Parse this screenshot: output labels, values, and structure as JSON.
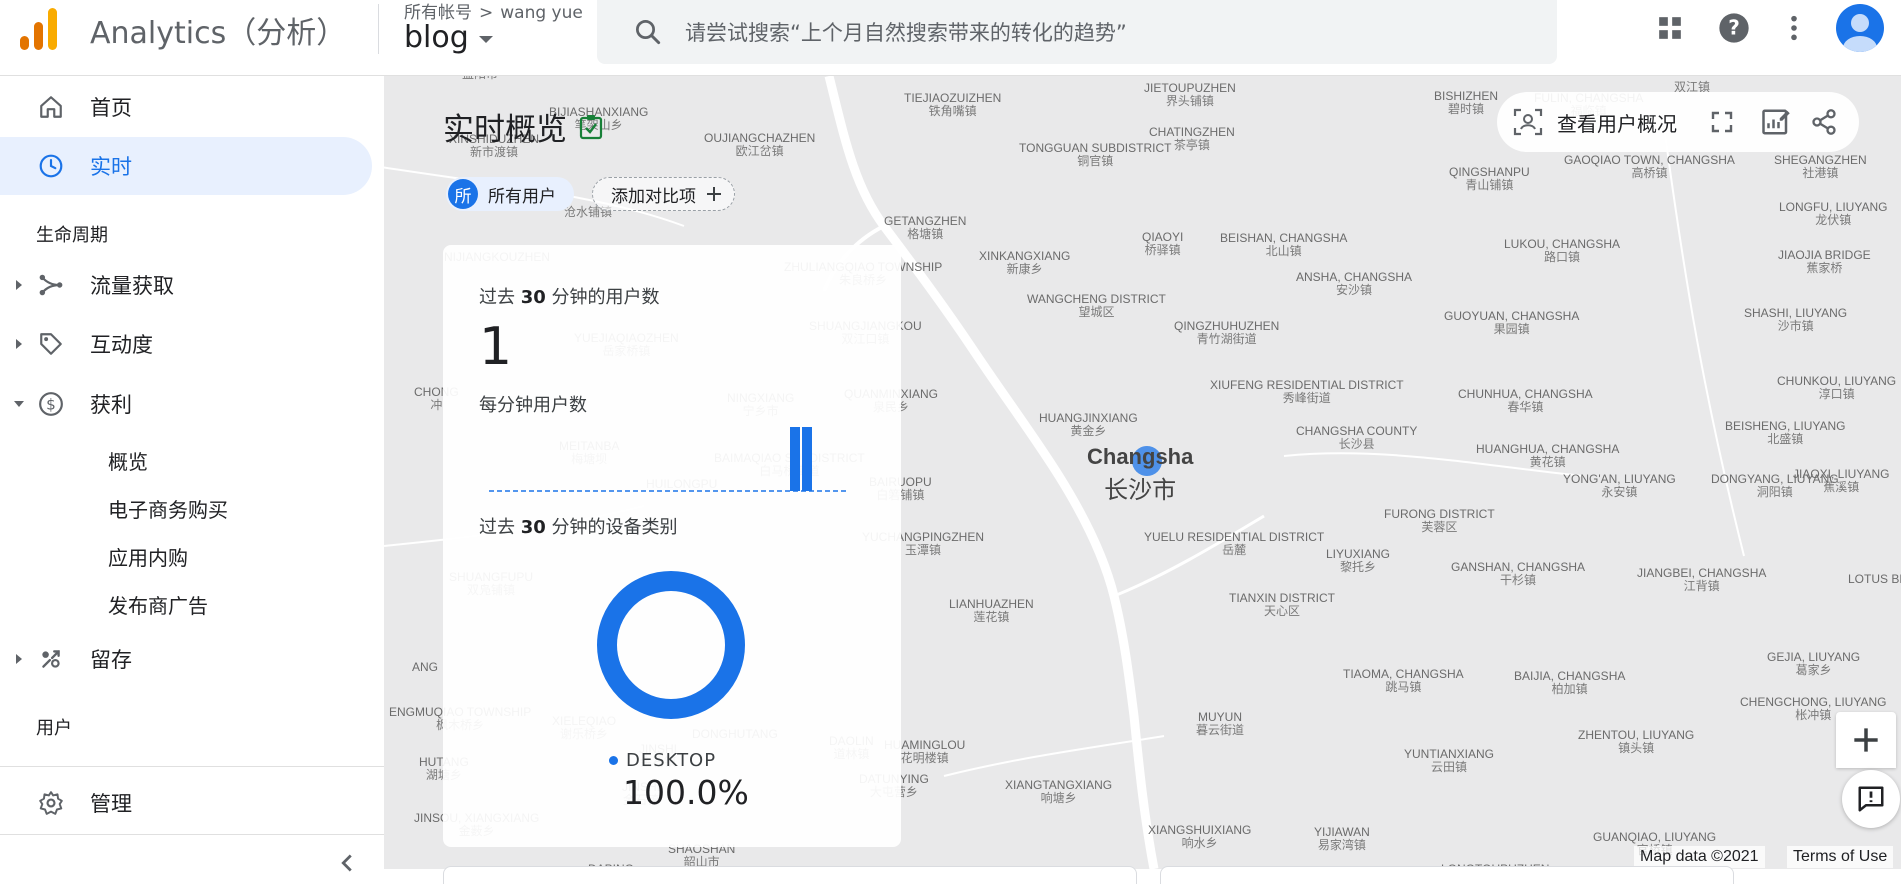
{
  "app": {
    "title": "Analytics（分析）",
    "account_label": "所有帐号",
    "crumb_separator": ">",
    "account_name": "wang yue",
    "property_name": "blog",
    "brand_colors": [
      "#f9ab00",
      "#e37400"
    ]
  },
  "search": {
    "placeholder": "请尝试搜索“上个月自然搜索带来的转化的趋势”",
    "icon": "search-icon"
  },
  "header_icons": [
    "apps-grid-icon",
    "help-icon",
    "more-vert-icon",
    "account-avatar-icon"
  ],
  "sidebar": {
    "home": "首页",
    "realtime": "实时",
    "lifecycle_heading": "生命周期",
    "acquisition": "流量获取",
    "engagement": "互动度",
    "monetization": "获利",
    "monetization_items": [
      "概览",
      "电子商务购买",
      "应用内购",
      "发布商广告"
    ],
    "retention": "留存",
    "user_heading": "用户",
    "admin": "管理"
  },
  "page": {
    "title": "实时概览",
    "segment_badge": "所",
    "segment": "所有用户",
    "add_comparison": "添加对比项",
    "view_user_snapshot": "查看用户概况"
  },
  "realtime_card": {
    "users_title_pre": "过去 ",
    "users_title_num": "30",
    "users_title_post": " 分钟的用户数",
    "users_value": "1",
    "per_minute_title": "每分钟用户数",
    "per_minute_series": [
      0,
      0,
      0,
      0,
      0,
      0,
      0,
      0,
      0,
      0,
      0,
      0,
      0,
      0,
      0,
      0,
      0,
      0,
      0,
      0,
      0,
      0,
      0,
      0,
      0,
      1,
      1,
      0,
      0,
      0
    ],
    "device_title_pre": "过去 ",
    "device_title_num": "30",
    "device_title_post": " 分钟的设备类别",
    "device_label": "DESKTOP",
    "device_percent": "100.0%",
    "device_share": 1.0,
    "accent_color": "#1a73e8"
  },
  "map": {
    "city_en": "Changsha",
    "city_zh": "长沙市",
    "credit": "Map data ©2021",
    "terms": "Terms of Use",
    "places": [
      {
        "en": "",
        "zh": "益阳市"
      },
      {
        "en": "BIJIASHANXIANG",
        "zh": "笔架山乡"
      },
      {
        "en": "TIEJIAOZUIZHEN",
        "zh": "铁角嘴镇"
      },
      {
        "en": "JIETOUPUZHEN",
        "zh": "界头铺镇"
      },
      {
        "en": "BISHIZHEN",
        "zh": "碧时镇"
      },
      {
        "en": "FULIN, CHANGSHA",
        "zh": "福临镇"
      },
      {
        "en": "XINSHIDUZHEN",
        "zh": "新市渡镇"
      },
      {
        "en": "OUJIANGCHAZHEN",
        "zh": "欧江岔镇"
      },
      {
        "en": "TONGGUAN SUBDISTRICT",
        "zh": "铜官镇"
      },
      {
        "en": "CHATINGZHEN",
        "zh": "茶亭镇"
      },
      {
        "en": "QINGSHANPU",
        "zh": "青山铺镇"
      },
      {
        "en": "GAOQIAO TOWN, CHANGSHA",
        "zh": "高桥镇"
      },
      {
        "en": "SHEGANGZHEN",
        "zh": "社港镇"
      },
      {
        "en": "",
        "zh": "沧水铺镇"
      },
      {
        "en": "GETANGZHEN",
        "zh": "格塘镇"
      },
      {
        "en": "QIAOYI",
        "zh": "桥驿镇"
      },
      {
        "en": "BEISHAN, CHANGSHA",
        "zh": "北山镇"
      },
      {
        "en": "LUKOU, CHANGSHA",
        "zh": "路口镇"
      },
      {
        "en": "LONGFU, LIUYANG",
        "zh": "龙伏镇"
      },
      {
        "en": "NIJIANGKOUZHEN",
        "zh": ""
      },
      {
        "en": "XINKANGXIANG",
        "zh": "新康乡"
      },
      {
        "en": "ANSHA, CHANGSHA",
        "zh": "安沙镇"
      },
      {
        "en": "JIAOJIA BRIDGE",
        "zh": "蕉家桥"
      },
      {
        "en": "ZHULIANGQIAO TOWNSHIP",
        "zh": "朱良桥乡"
      },
      {
        "en": "WANGCHENG DISTRICT",
        "zh": "望城区"
      },
      {
        "en": "GUOYUAN, CHANGSHA",
        "zh": "果园镇"
      },
      {
        "en": "SHASHI, LIUYANG",
        "zh": "沙市镇"
      },
      {
        "en": "QINGZHUHUZHEN",
        "zh": "青竹湖街道"
      },
      {
        "en": "SHUANGJIANGKOU",
        "zh": "双江口镇"
      },
      {
        "en": "YUEJIAQIAOZHEN",
        "zh": "岳家桥镇"
      },
      {
        "en": "CHONG",
        "zh": "冲"
      },
      {
        "en": "XIUFENG RESIDENTIAL DISTRICT",
        "zh": "秀峰街道"
      },
      {
        "en": "CHUNHUA, CHANGSHA",
        "zh": "春华镇"
      },
      {
        "en": "CHUNKOU, LIUYANG",
        "zh": "淳口镇"
      },
      {
        "en": "NINGXIANG",
        "zh": "宁乡市"
      },
      {
        "en": "QUANMINXIANG",
        "zh": "泉民乡"
      },
      {
        "en": "HUANGJINXIANG",
        "zh": "黄金乡"
      },
      {
        "en": "CHANGSHA COUNTY",
        "zh": "长沙县"
      },
      {
        "en": "HUANGHUA, CHANGSHA",
        "zh": "黄花镇"
      },
      {
        "en": "BEISHENG, LIUYANG",
        "zh": "北盛镇"
      },
      {
        "en": "MEITANBA",
        "zh": "梅塘坝"
      },
      {
        "en": "BAIMAQIAO SUBDISTRICT",
        "zh": "白马桥街道"
      },
      {
        "en": "BAIRUOPU",
        "zh": "白箬铺镇"
      },
      {
        "en": "YONG'AN, LIUYANG",
        "zh": "永安镇"
      },
      {
        "en": "DONGYANG, LIUYANG",
        "zh": "洞阳镇"
      },
      {
        "en": "JIAOXI, LIUYANG",
        "zh": "蕉溪镇"
      },
      {
        "en": "HUILONGPU",
        "zh": ""
      },
      {
        "en": "FURONG DISTRICT",
        "zh": "芙蓉区"
      },
      {
        "en": "YUCHANGPINGZHEN",
        "zh": "玉潭镇"
      },
      {
        "en": "YUELU RESIDENTIAL DISTRICT",
        "zh": "岳麓"
      },
      {
        "en": "LIYUXIANG",
        "zh": "黎托乡"
      },
      {
        "en": "SHUANGFUPU",
        "zh": "双凫铺镇"
      },
      {
        "en": "GANSHAN, CHANGSHA",
        "zh": "干杉镇"
      },
      {
        "en": "JIANGBEI, CHANGSHA",
        "zh": "江背镇"
      },
      {
        "en": "LOTUS BRIDGE COMM.",
        "zh": "荷花"
      },
      {
        "en": "LIANHUAZHEN",
        "zh": "莲花镇"
      },
      {
        "en": "TIANXIN DISTRICT",
        "zh": "天心区"
      },
      {
        "en": "ANG",
        "zh": ""
      },
      {
        "en": "TIAOMA, CHANGSHA",
        "zh": "跳马镇"
      },
      {
        "en": "BAIJIA, CHANGSHA",
        "zh": "柏加镇"
      },
      {
        "en": "GEJIA, LIUYANG",
        "zh": "葛家乡"
      },
      {
        "en": "ENGMUQIAO TOWNSHIP",
        "zh": "枫木桥乡"
      },
      {
        "en": "XIELEQIAO",
        "zh": "谢乐桥乡"
      },
      {
        "en": "DONGHUTANG",
        "zh": ""
      },
      {
        "en": "HUAMINGLOU",
        "zh": "花明楼镇"
      },
      {
        "en": "CHENGCHONG, LIUYANG",
        "zh": "枨冲镇"
      },
      {
        "en": "MUYUN",
        "zh": "暮云街道"
      },
      {
        "en": "ZHENTOU, LIUYANG",
        "zh": "镇头镇"
      },
      {
        "en": "YUNTIANXIANG",
        "zh": "云田镇"
      },
      {
        "en": "HUTANG",
        "zh": "湖塘乡"
      },
      {
        "en": "JINSHI",
        "zh": "金石镇"
      },
      {
        "en": "DAOLIN",
        "zh": "道林镇"
      },
      {
        "en": "DATUNYING",
        "zh": "大屯营乡"
      },
      {
        "en": "XIANGTANGXIANG",
        "zh": "响塘乡"
      },
      {
        "en": "XIANGSHUIXIANG",
        "zh": "响水乡"
      },
      {
        "en": "YIJIAWAN",
        "zh": "易家湾镇"
      },
      {
        "en": "JINSOU, XIANGXIANG",
        "zh": "金薮乡"
      },
      {
        "en": "SHAOSHAN",
        "zh": "韶山市"
      },
      {
        "en": "DAPING",
        "zh": ""
      },
      {
        "en": "LONGTOUPUZHEN",
        "zh": "龙头铺镇"
      },
      {
        "en": "GUANQIAO, LIUYANG",
        "zh": "官桥镇"
      },
      {
        "en": "",
        "zh": "双江镇"
      },
      {
        "en": "JINSHI",
        "zh": "金石镇"
      }
    ]
  }
}
